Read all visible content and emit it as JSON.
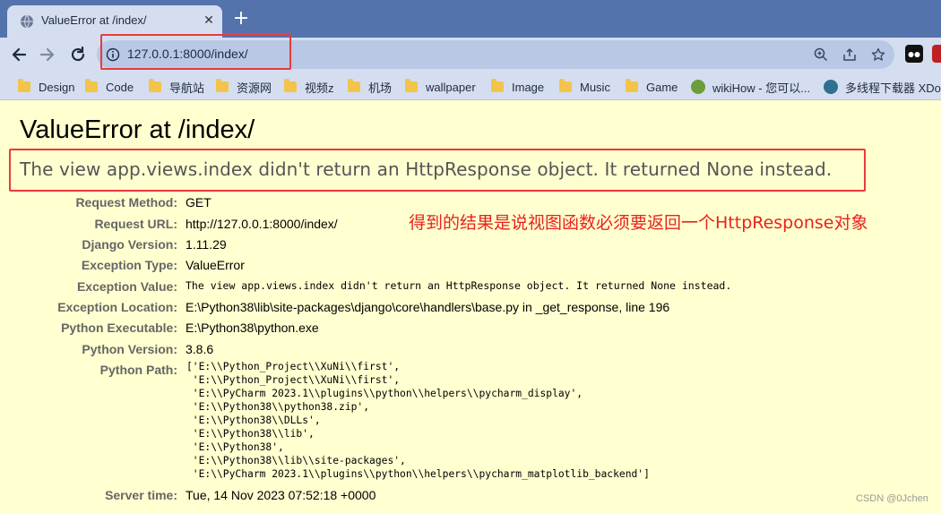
{
  "browser": {
    "tab_title": "ValueError at /index/",
    "tab_close": "✕",
    "new_tab": "+",
    "url": "127.0.0.1:8000/index/",
    "bookmarks": [
      {
        "label": "Design",
        "icon": "folder-icon"
      },
      {
        "label": "Code",
        "icon": "folder-icon"
      },
      {
        "label": "导航站",
        "icon": "folder-icon"
      },
      {
        "label": "资源网",
        "icon": "folder-icon"
      },
      {
        "label": "视频z",
        "icon": "folder-icon"
      },
      {
        "label": "机场",
        "icon": "folder-icon"
      },
      {
        "label": "wallpaper",
        "icon": "folder-icon"
      },
      {
        "label": "Image",
        "icon": "folder-icon"
      },
      {
        "label": "Music",
        "icon": "folder-icon"
      },
      {
        "label": "Game",
        "icon": "folder-icon"
      },
      {
        "label": "wikiHow - 您可以...",
        "icon": "wikihow-icon"
      },
      {
        "label": "多线程下载器 XDo...",
        "icon": "xdown-icon"
      }
    ]
  },
  "page": {
    "title": "ValueError at /index/",
    "summary": "The view app.views.index didn't return an HttpResponse object. It returned None instead.",
    "annotation": "得到的结果是说视图函数必须要返回一个HttpResponse对象",
    "rows": {
      "request_method": {
        "label": "Request Method:",
        "value": "GET"
      },
      "request_url": {
        "label": "Request URL:",
        "value": "http://127.0.0.1:8000/index/"
      },
      "django_version": {
        "label": "Django Version:",
        "value": "1.11.29"
      },
      "exception_type": {
        "label": "Exception Type:",
        "value": "ValueError"
      },
      "exception_value": {
        "label": "Exception Value:",
        "value": "The view app.views.index didn't return an HttpResponse object. It returned None instead."
      },
      "exception_location": {
        "label": "Exception Location:",
        "value": "E:\\Python38\\lib\\site-packages\\django\\core\\handlers\\base.py in _get_response, line 196"
      },
      "python_executable": {
        "label": "Python Executable:",
        "value": "E:\\Python38\\python.exe"
      },
      "python_version": {
        "label": "Python Version:",
        "value": "3.8.6"
      },
      "python_path": {
        "label": "Python Path:",
        "value": "['E:\\\\Python_Project\\\\XuNi\\\\first',\n 'E:\\\\Python_Project\\\\XuNi\\\\first',\n 'E:\\\\PyCharm 2023.1\\\\plugins\\\\python\\\\helpers\\\\pycharm_display',\n 'E:\\\\Python38\\\\python38.zip',\n 'E:\\\\Python38\\\\DLLs',\n 'E:\\\\Python38\\\\lib',\n 'E:\\\\Python38',\n 'E:\\\\Python38\\\\lib\\\\site-packages',\n 'E:\\\\PyCharm 2023.1\\\\plugins\\\\python\\\\helpers\\\\pycharm_matplotlib_backend']"
      },
      "server_time": {
        "label": "Server time:",
        "value": "Tue, 14 Nov 2023 07:52:18 +0000"
      }
    },
    "watermark": "CSDN @0Jchen"
  },
  "colors": {
    "tab_strip": "#5473ad",
    "toolbar": "#d5def0",
    "page_background": "#ffffd0",
    "highlight_red": "#e83b3b",
    "annotation_red": "#e8231b"
  }
}
